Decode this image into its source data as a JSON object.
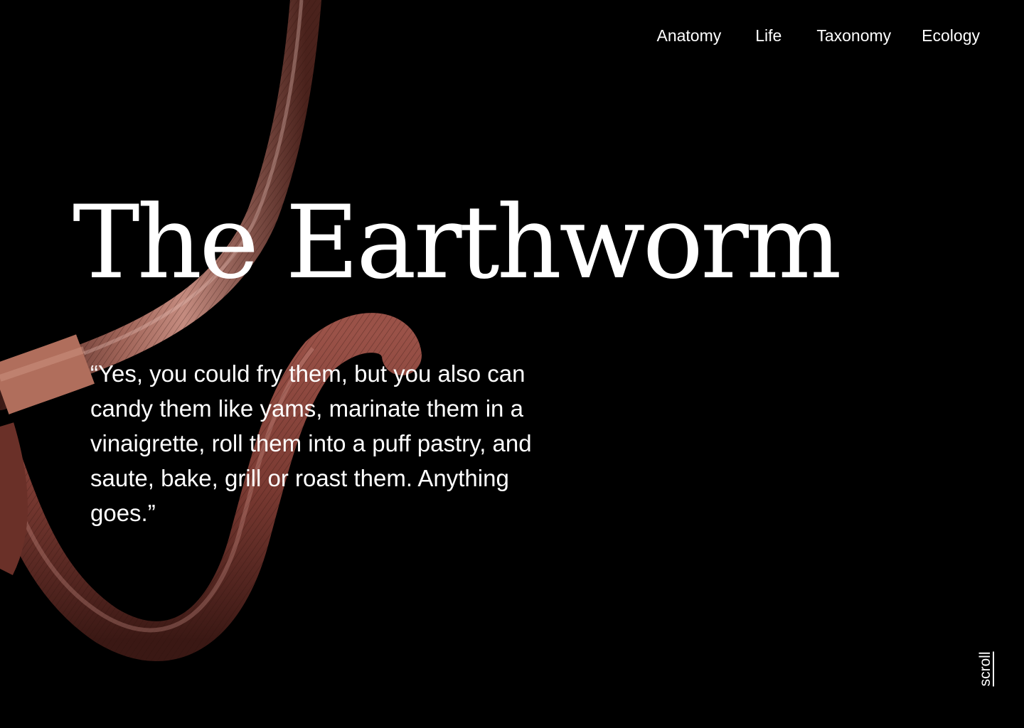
{
  "colors": {
    "background": "#000000",
    "text": "#ffffff",
    "worm_dark": "#4a2520",
    "worm_mid": "#8a4a40",
    "worm_light": "#c98a7e",
    "clitellum": "#b06e5c"
  },
  "nav": {
    "items": [
      {
        "label": "Anatomy"
      },
      {
        "label": "Life"
      },
      {
        "label": "Taxonomy"
      },
      {
        "label": "Ecology"
      }
    ]
  },
  "hero": {
    "title": "The Earthworm",
    "image_subject": "earthworm-photo"
  },
  "quote": {
    "text": "“Yes, you could fry them, but you also can candy them like yams, marinate them in a vinaigrette, roll them into a puff pastry, and saute, bake, grill or roast them. Anything goes.”"
  },
  "scroll": {
    "label": "scroll"
  }
}
